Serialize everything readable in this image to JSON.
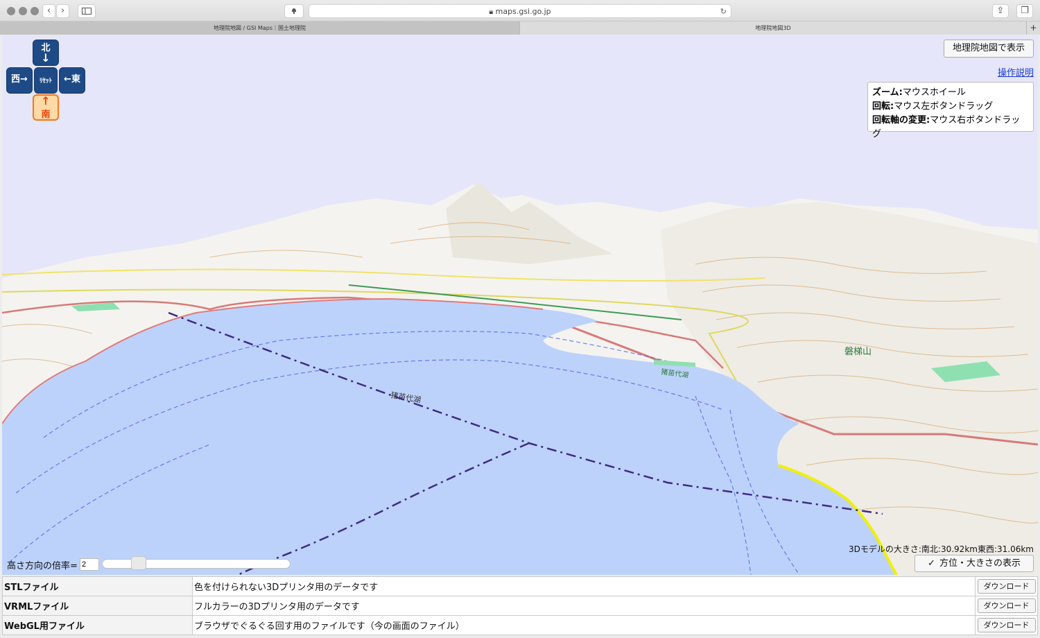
{
  "browser": {
    "url": "maps.gsi.go.jp",
    "tabs": [
      {
        "label": "地理院地図 / GSI Maps｜国土地理院",
        "active": true
      },
      {
        "label": "地理院地図3D",
        "active": false
      }
    ],
    "new_tab_label": "+"
  },
  "viewer": {
    "direction_buttons": {
      "north": "北",
      "west": "西",
      "reset": "ﾘｾｯﾄ",
      "east": "東",
      "south": "南"
    },
    "show_in_gsi_label": "地理院地図で表示",
    "help_link": "操作説明",
    "help": [
      {
        "key": "ズーム:",
        "value": "マウスホイール"
      },
      {
        "key": "回転:",
        "value": "マウス左ボタンドラッグ"
      },
      {
        "key": "回転軸の変更:",
        "value": "マウス右ボタンドラッグ"
      }
    ],
    "model_size": "3Dモデルの大きさ:南北:30.92km東西:31.06km",
    "toggle_label": "方位・大きさの表示",
    "height_label": "高さ方向の倍率=",
    "height_value": "2",
    "height_slider_fraction": 0.2,
    "map_labels": {
      "lake": "猪苗代湖",
      "lake_south": "猪苗代湖",
      "mountain": "磐梯山"
    },
    "colors": {
      "sky": "#e6e6fa",
      "water": "#bdd2fb",
      "nav_blue": "#1e4a86",
      "nav_orange": "#f07a16"
    }
  },
  "downloads": [
    {
      "name": "STLファイル",
      "description": "色を付けられない3Dプリンタ用のデータです",
      "button": "ダウンロード"
    },
    {
      "name": "VRMLファイル",
      "description": "フルカラーの3Dプリンタ用のデータです",
      "button": "ダウンロード"
    },
    {
      "name": "WebGL用ファイル",
      "description": "ブラウザでぐるぐる回す用のファイルです（今の画面のファイル）",
      "button": "ダウンロード"
    }
  ]
}
